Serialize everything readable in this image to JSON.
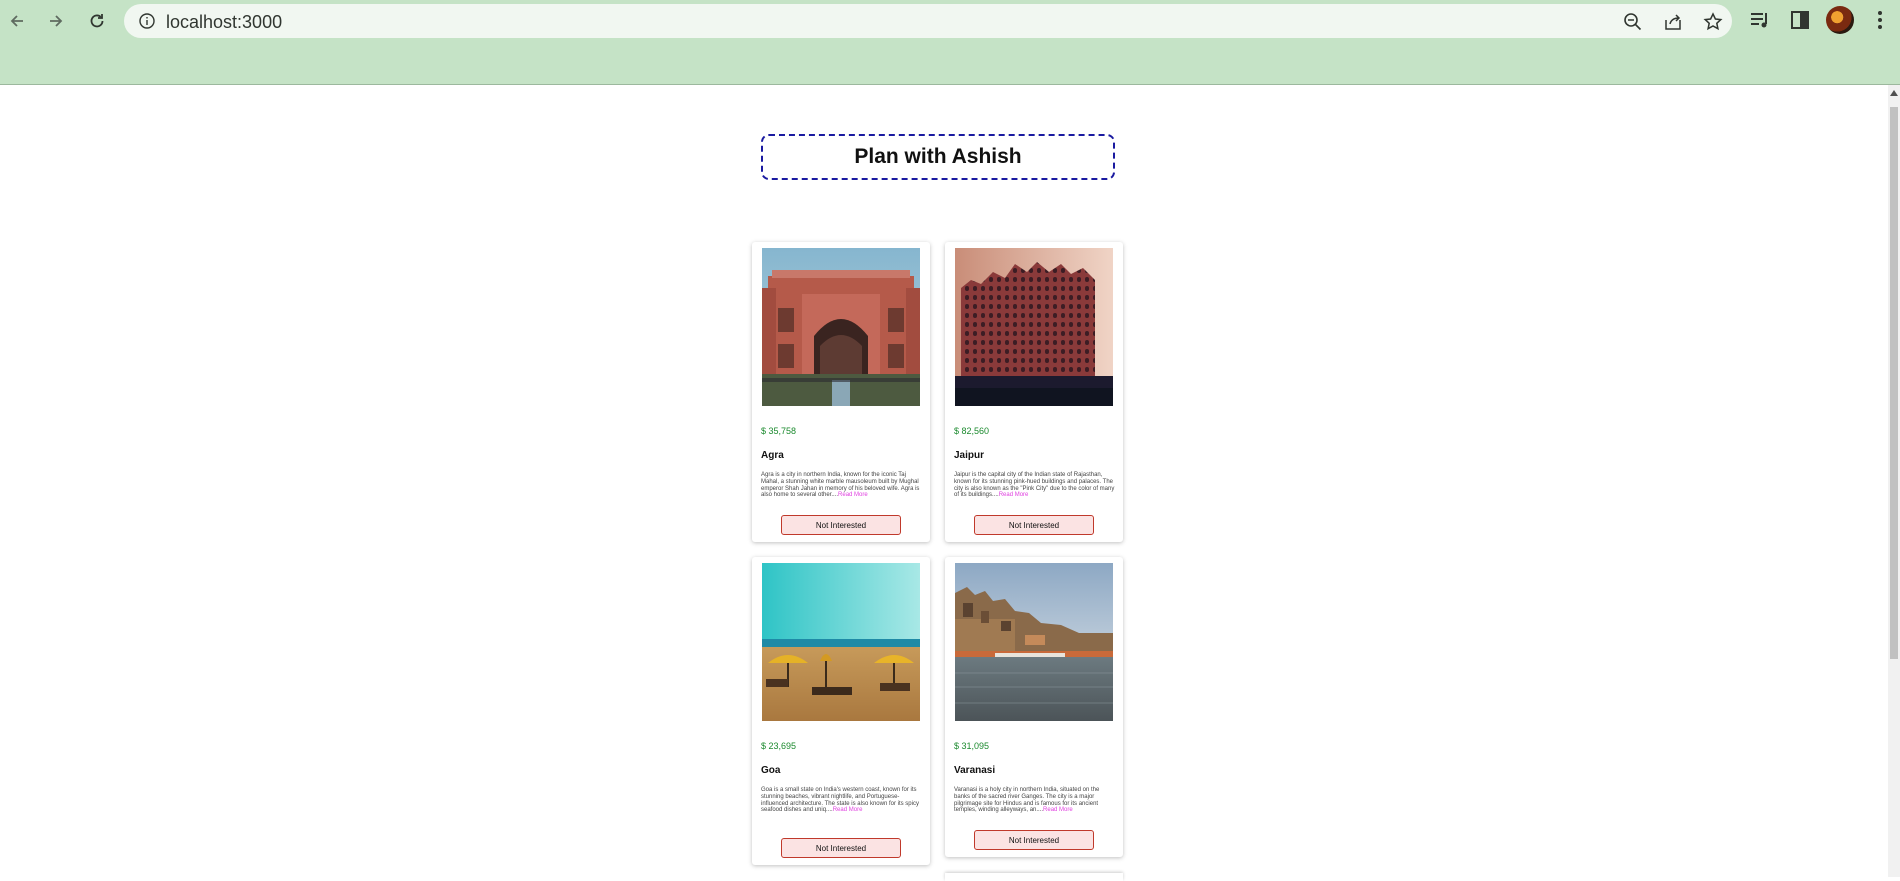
{
  "browser": {
    "url": "localhost:3000"
  },
  "page": {
    "title": "Plan with Ashish"
  },
  "tours": [
    {
      "price": "$ 35,758",
      "name": "Agra",
      "description": "Agra is a city in northern India, known for the iconic Taj Mahal, a stunning white marble mausoleum built by Mughal emperor Shah Jahan in memory of his beloved wife. Agra is also home to several other....",
      "read_more": "Read More",
      "button": "Not Interested"
    },
    {
      "price": "$ 82,560",
      "name": "Jaipur",
      "description": "Jaipur is the capital city of the Indian state of Rajasthan, known for its stunning pink-hued buildings and palaces. The city is also known as the \"Pink City\" due to the color of many of its buildings....",
      "read_more": "Read More",
      "button": "Not Interested"
    },
    {
      "price": "$ 23,695",
      "name": "Goa",
      "description": "Goa is a small state on India's western coast, known for its stunning beaches, vibrant nightlife, and Portuguese-influenced architecture. The state is also known for its spicy seafood dishes and uniq....",
      "read_more": "Read More",
      "button": "Not Interested"
    },
    {
      "price": "$ 31,095",
      "name": "Varanasi",
      "description": "Varanasi is a holy city in northern India, situated on the banks of the sacred river Ganges. The city is a major pilgrimage site for Hindus and is famous for its ancient temples, winding alleyways, an....",
      "read_more": "Read More",
      "button": "Not Interested"
    }
  ]
}
